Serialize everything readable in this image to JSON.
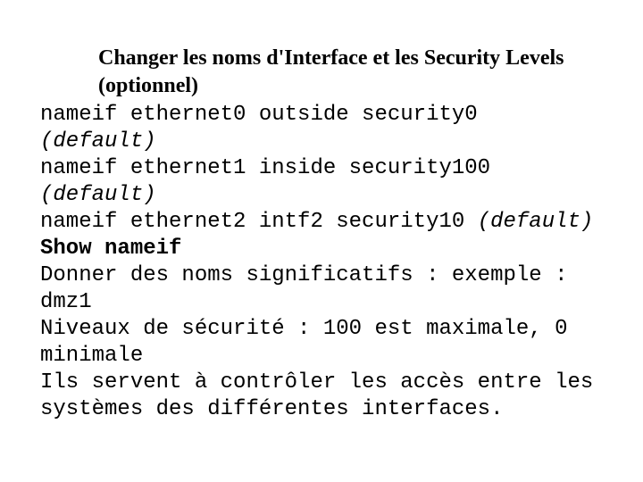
{
  "heading": "Changer les noms d'Interface et les Security Levels (optionnel)",
  "cmd1": "nameif ethernet0 outside security0",
  "def1": "(default)",
  "cmd2": "nameif ethernet1 inside security100",
  "def2": "(default)",
  "cmd3_a": "nameif ethernet2 intf2 security10",
  "cmd3_b": "(default)",
  "show": "Show nameif",
  "note1": "Donner des noms significatifs : exemple : dmz1",
  "note2": "Niveaux de sécurité : 100 est maximale, 0 minimale",
  "note3": "Ils servent à contrôler les accès entre les systèmes des  différentes interfaces."
}
